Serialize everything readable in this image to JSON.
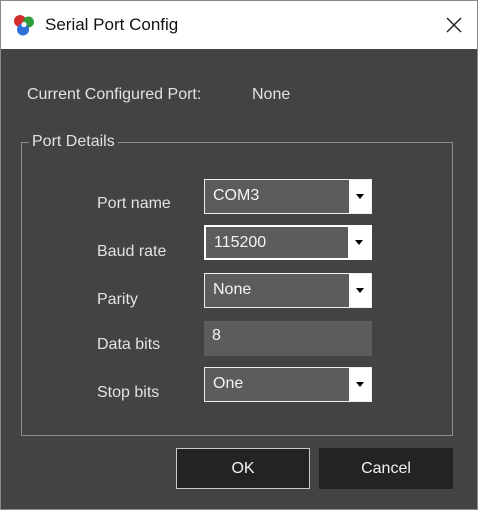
{
  "window": {
    "title": "Serial Port Config",
    "app_icon": "app-logo-icon",
    "close_icon": "close-icon"
  },
  "current_port": {
    "label": "Current Configured Port:",
    "value": "None"
  },
  "port_details": {
    "group_title": "Port Details",
    "fields": {
      "port_name": {
        "label": "Port name",
        "value": "COM3"
      },
      "baud_rate": {
        "label": "Baud rate",
        "value": "115200"
      },
      "parity": {
        "label": "Parity",
        "value": "None"
      },
      "data_bits": {
        "label": "Data bits",
        "value": "8"
      },
      "stop_bits": {
        "label": "Stop bits",
        "value": "One"
      }
    }
  },
  "buttons": {
    "ok": "OK",
    "cancel": "Cancel"
  },
  "colors": {
    "dialog_background": "#434343",
    "field_background": "#5c5c5c",
    "button_background": "#232323",
    "text": "#e2e2e2"
  }
}
